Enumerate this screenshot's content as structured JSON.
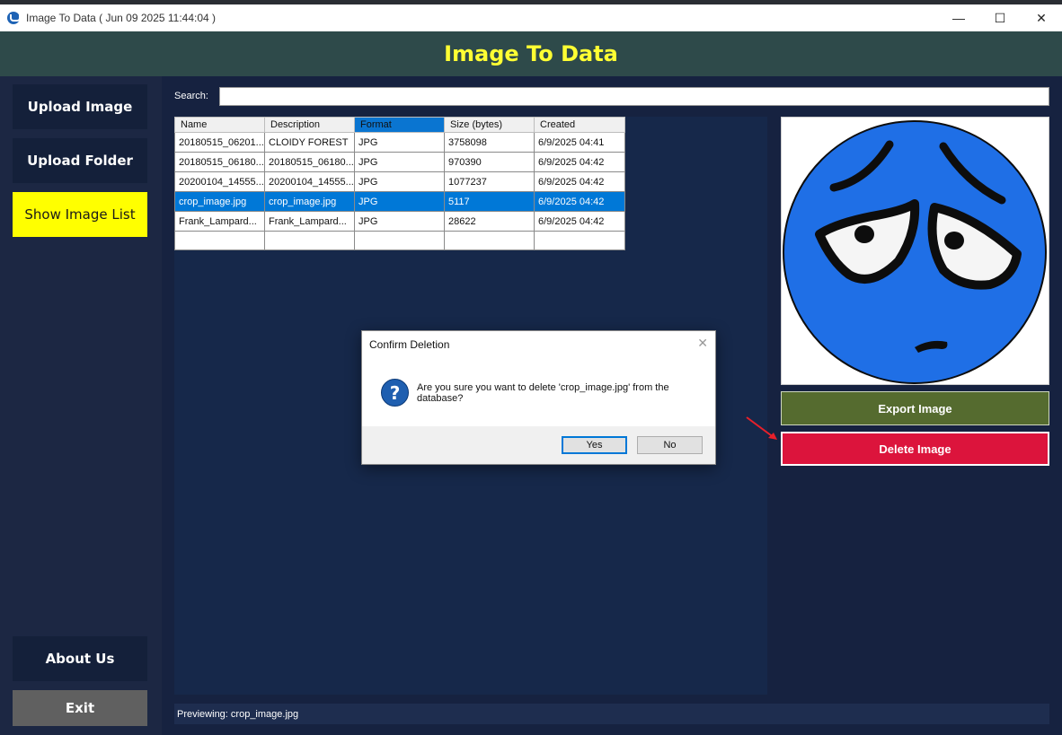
{
  "window": {
    "title": "Image To Data ( Jun 09 2025 11:44:04 )",
    "controls": {
      "minimize": "—",
      "maximize": "☐",
      "close": "✕"
    }
  },
  "header": {
    "title": "Image To Data",
    "title_color": "#ffff33"
  },
  "sidebar": {
    "upload_image": "Upload Image",
    "upload_folder": "Upload Folder",
    "show_image_list": "Show Image List",
    "about_us": "About Us",
    "exit": "Exit",
    "active_color": "#ffff00"
  },
  "search": {
    "label": "Search:",
    "value": ""
  },
  "table": {
    "columns": [
      "Name",
      "Description",
      "Format",
      "Size (bytes)",
      "Created"
    ],
    "sorted_column": "Format",
    "rows": [
      {
        "name": "20180515_06201...",
        "description": "CLOIDY FOREST",
        "format": "JPG",
        "size": "3758098",
        "created": "6/9/2025 04:41"
      },
      {
        "name": "20180515_06180...",
        "description": "20180515_06180...",
        "format": "JPG",
        "size": "970390",
        "created": "6/9/2025 04:42"
      },
      {
        "name": "20200104_14555...",
        "description": "20200104_14555...",
        "format": "JPG",
        "size": "1077237",
        "created": "6/9/2025 04:42"
      },
      {
        "name": "crop_image.jpg",
        "description": "crop_image.jpg",
        "format": "JPG",
        "size": "5117",
        "created": "6/9/2025 04:42"
      },
      {
        "name": "Frank_Lampard...",
        "description": "Frank_Lampard...",
        "format": "JPG",
        "size": "28622",
        "created": "6/9/2025 04:42"
      }
    ],
    "selected_row": 3
  },
  "preview": {
    "image": "sad-blue-face-emoji",
    "export_label": "Export Image",
    "delete_label": "Delete Image",
    "export_color": "#556b2f",
    "delete_color": "#dc143c"
  },
  "status": {
    "text": "Previewing: crop_image.jpg"
  },
  "dialog": {
    "title": "Confirm Deletion",
    "close": "✕",
    "icon": "question-icon",
    "message": "Are you sure you want to delete 'crop_image.jpg' from the database?",
    "yes_label": "Yes",
    "no_label": "No"
  }
}
